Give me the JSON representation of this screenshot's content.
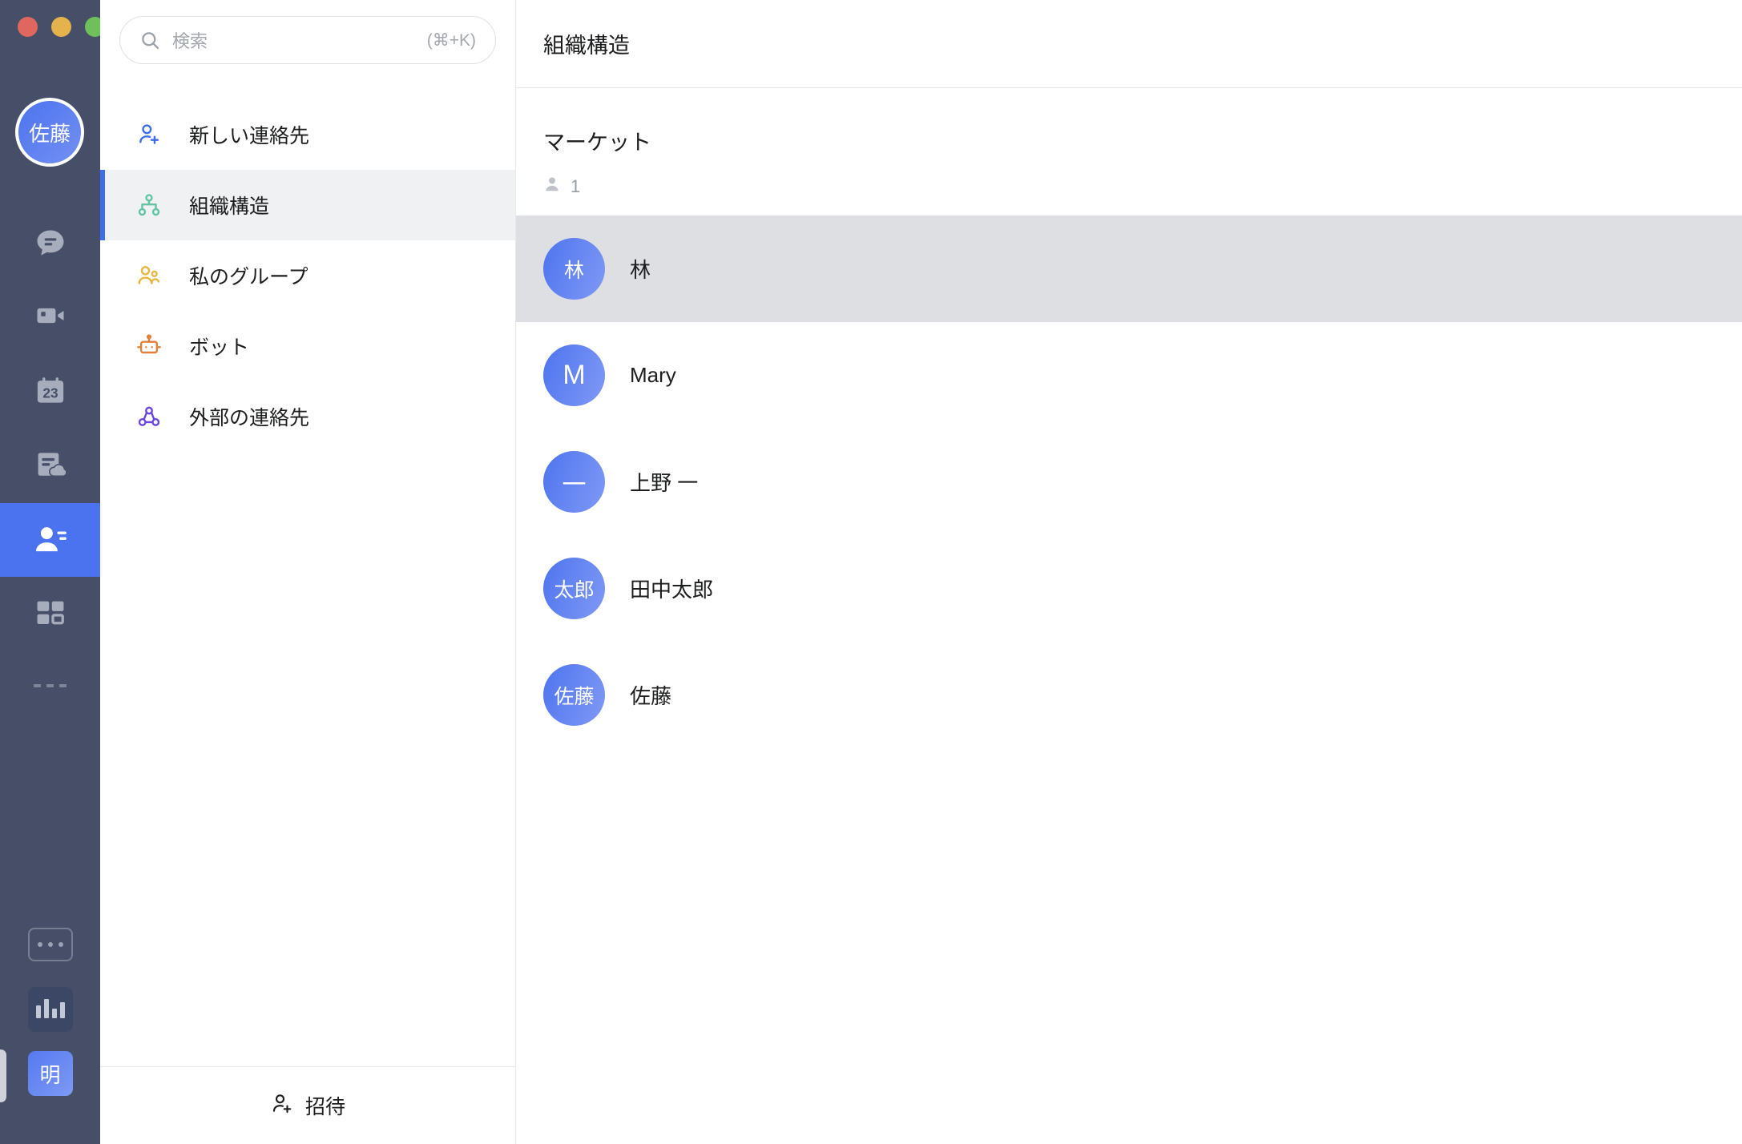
{
  "window": {
    "traffic_lights": [
      {
        "name": "close",
        "color": "#e0675f"
      },
      {
        "name": "minimize",
        "color": "#e5b34b"
      },
      {
        "name": "zoom",
        "color": "#6ec05c"
      }
    ]
  },
  "rail": {
    "avatar_initials": "佐藤",
    "items": [
      {
        "icon": "chat-bubble-icon",
        "name": "rail-item-chat",
        "active": false
      },
      {
        "icon": "video-camera-icon",
        "name": "rail-item-meetings",
        "active": false
      },
      {
        "icon": "calendar-23-icon",
        "name": "rail-item-calendar",
        "active": false
      },
      {
        "icon": "docs-cloud-icon",
        "name": "rail-item-docs",
        "active": false
      },
      {
        "icon": "contacts-icon",
        "name": "rail-item-contacts",
        "active": true
      },
      {
        "icon": "apps-grid-icon",
        "name": "rail-item-workplace",
        "active": false
      },
      {
        "icon": "more-dots-icon",
        "name": "rail-item-more",
        "active": false
      }
    ],
    "bottom": {
      "more_label": "…",
      "chart_name": "stats-icon",
      "language_badge": "明"
    }
  },
  "search": {
    "placeholder": "検索",
    "shortcut": "(⌘+K)",
    "value": ""
  },
  "nav": {
    "items": [
      {
        "label": "新しい連絡先",
        "icon": "user-plus-icon",
        "color": "#3f6dea",
        "selected": false
      },
      {
        "label": "組織構造",
        "icon": "org-tree-icon",
        "color": "#63c4a2",
        "selected": true
      },
      {
        "label": "私のグループ",
        "icon": "users-group-icon",
        "color": "#e9b53f",
        "selected": false
      },
      {
        "label": "ボット",
        "icon": "robot-icon",
        "color": "#e1803b",
        "selected": false
      },
      {
        "label": "外部の連絡先",
        "icon": "external-contacts-icon",
        "color": "#6b45e0",
        "selected": false
      }
    ]
  },
  "invite": {
    "label": "招待",
    "icon": "user-plus-icon"
  },
  "main": {
    "title": "組織構造",
    "group": {
      "name": "マーケット",
      "member_count": "1",
      "member_count_icon": "person-icon"
    },
    "members": [
      {
        "avatar_text": "林",
        "name": "林",
        "avatar_type": "kanji",
        "selected": true
      },
      {
        "avatar_text": "M",
        "name": "Mary",
        "avatar_type": "initial",
        "selected": false
      },
      {
        "avatar_text": "一",
        "name": "上野 一",
        "avatar_type": "dash",
        "selected": false
      },
      {
        "avatar_text": "太郎",
        "name": "田中太郎",
        "avatar_type": "kanji",
        "selected": false
      },
      {
        "avatar_text": "佐藤",
        "name": "佐藤",
        "avatar_type": "kanji",
        "selected": false
      }
    ]
  },
  "colors": {
    "rail_bg": "#474f68",
    "accent": "#3f6dea",
    "selected_row": "#dddfe2",
    "selected_nav": "#f0f1f3"
  }
}
